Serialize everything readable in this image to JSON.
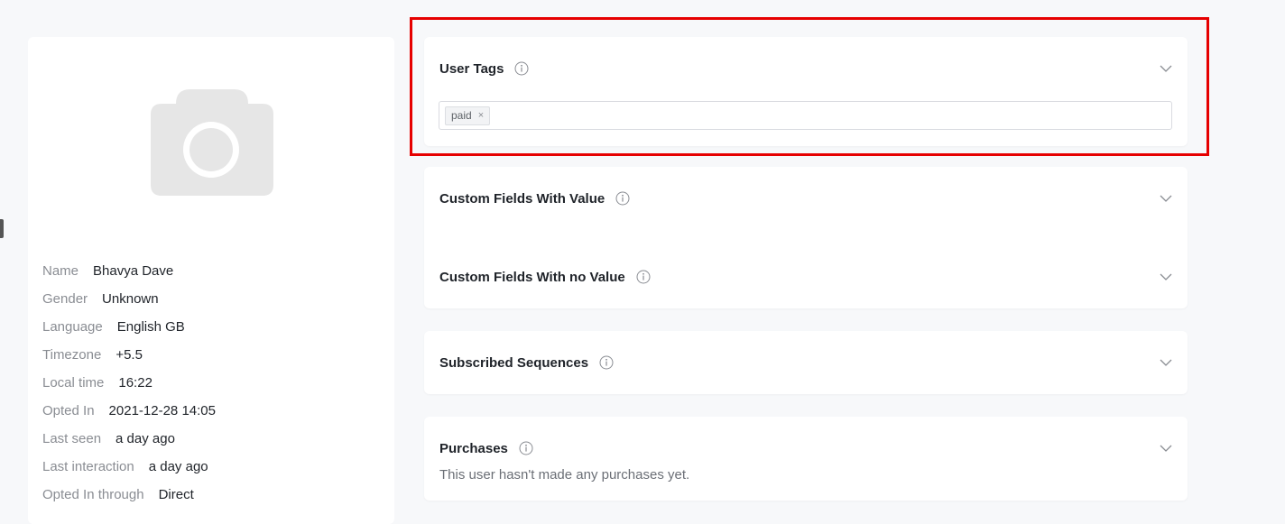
{
  "profile": {
    "fields": [
      {
        "label": "Name",
        "value": "Bhavya Dave"
      },
      {
        "label": "Gender",
        "value": "Unknown"
      },
      {
        "label": "Language",
        "value": "English GB"
      },
      {
        "label": "Timezone",
        "value": "+5.5"
      },
      {
        "label": "Local time",
        "value": "16:22"
      },
      {
        "label": "Opted In",
        "value": "2021-12-28 14:05"
      },
      {
        "label": "Last seen",
        "value": "a day ago"
      },
      {
        "label": "Last interaction",
        "value": "a day ago"
      },
      {
        "label": "Opted In through",
        "value": "Direct"
      }
    ],
    "avatar_icon": "camera-icon"
  },
  "sections": {
    "user_tags": {
      "title": "User Tags",
      "tags": [
        {
          "label": "paid",
          "remove": "×"
        }
      ]
    },
    "custom_with_value": {
      "title": "Custom Fields With Value"
    },
    "custom_no_value": {
      "title": "Custom Fields With no Value"
    },
    "subscribed_sequences": {
      "title": "Subscribed Sequences"
    },
    "purchases": {
      "title": "Purchases",
      "empty_text": "This user hasn't made any purchases yet."
    }
  },
  "colors": {
    "highlight": "#e60000",
    "background": "#f7f8fa",
    "card": "#ffffff"
  }
}
